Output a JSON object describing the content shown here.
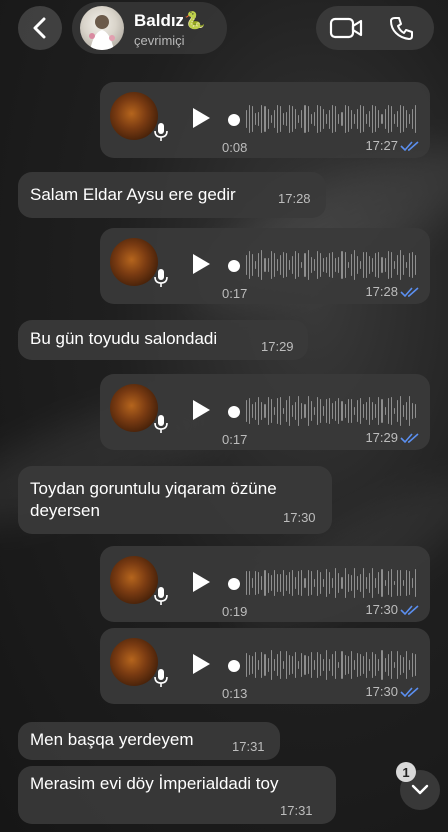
{
  "header": {
    "contact_name": "Baldız🐍",
    "contact_status": "çevrimiçi"
  },
  "messages": [
    {
      "type": "voice",
      "duration": "0:08",
      "time": "17:27",
      "outgoing": true,
      "read": true
    },
    {
      "type": "text",
      "text": "Salam Eldar Aysu ere gedir",
      "time": "17:28",
      "outgoing": false
    },
    {
      "type": "voice",
      "duration": "0:17",
      "time": "17:28",
      "outgoing": true,
      "read": true
    },
    {
      "type": "text",
      "text": "Bu gün toyudu salondadi",
      "time": "17:29",
      "outgoing": false
    },
    {
      "type": "voice",
      "duration": "0:17",
      "time": "17:29",
      "outgoing": true,
      "read": true
    },
    {
      "type": "text",
      "text_line1": "Toydan goruntulu yiqaram özüne",
      "text_line2": "deyersen",
      "time": "17:30",
      "outgoing": false
    },
    {
      "type": "voice",
      "duration": "0:19",
      "time": "17:30",
      "outgoing": true,
      "read": true
    },
    {
      "type": "voice",
      "duration": "0:13",
      "time": "17:30",
      "outgoing": true,
      "read": true
    },
    {
      "type": "text",
      "text": "Men başqa yerdeyem",
      "time": "17:31",
      "outgoing": false
    },
    {
      "type": "text",
      "text": "Merasim evi döy İmperialdadi toy",
      "time": "17:31",
      "outgoing": false
    }
  ],
  "scroll_down": {
    "unread_count": "1"
  },
  "colors": {
    "read_ticks": "#5b8ff0",
    "bubble": "#3a3a3a",
    "background": "#1c1c1c"
  },
  "icons": [
    "back-arrow-icon",
    "video-camera-icon",
    "phone-icon",
    "play-icon",
    "microphone-icon",
    "double-check-icon",
    "chevron-down-icon"
  ]
}
